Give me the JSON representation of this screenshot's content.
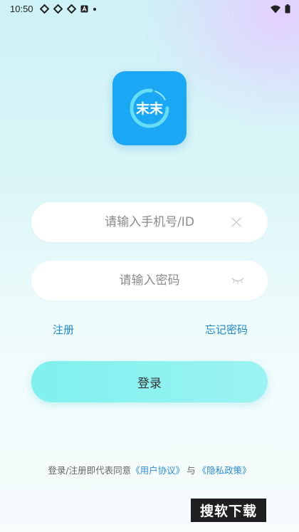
{
  "status_bar": {
    "time": "10:50",
    "notification_icons": [
      "notification-icon",
      "notification-icon",
      "notification-icon",
      "text-notification-icon",
      "dot-icon"
    ],
    "system_icons": [
      "wifi-icon",
      "battery-icon"
    ]
  },
  "app": {
    "logo_text": "末末",
    "brand_color": "#1aa7f4"
  },
  "login_form": {
    "phone_placeholder": "请输入手机号/ID",
    "phone_value": "",
    "password_placeholder": "请输入密码",
    "password_value": "",
    "register_label": "注册",
    "forgot_password_label": "忘记密码",
    "login_button_label": "登录",
    "accent_color": "#7ff1ee"
  },
  "agreement": {
    "prefix": "登录/注册即代表同意",
    "user_agreement": "《用户协议》",
    "conjunction": "与",
    "privacy_policy": "《隐私政策》",
    "link_color": "#2a8cd6"
  },
  "watermark": {
    "text": "搜软下载"
  }
}
